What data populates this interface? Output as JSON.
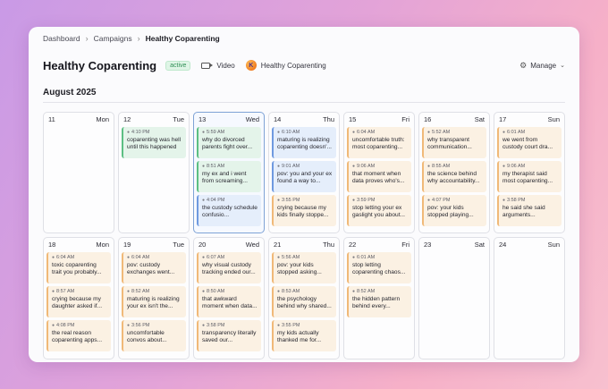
{
  "breadcrumb": [
    "Dashboard",
    "Campaigns",
    "Healthy Coparenting"
  ],
  "header": {
    "title": "Healthy Coparenting",
    "status": "active",
    "format": "Video",
    "account": "Healthy Coparenting",
    "manage": "Manage"
  },
  "month": "August 2025",
  "colors": {
    "peach": "#f0b978",
    "green": "#5cbf83",
    "blue": "#6f9ae0"
  },
  "days": [
    {
      "num": "11",
      "dow": "Mon",
      "events": []
    },
    {
      "num": "12",
      "dow": "Tue",
      "events": [
        {
          "time": "4:10 PM",
          "text": "coparenting was hell until this happened",
          "color": "green"
        }
      ]
    },
    {
      "num": "13",
      "dow": "Wed",
      "today": true,
      "events": [
        {
          "time": "5:59 AM",
          "text": "why do divorced parents fight over...",
          "color": "green"
        },
        {
          "time": "8:51 AM",
          "text": "my ex and i went from screaming...",
          "color": "green"
        },
        {
          "time": "4:04 PM",
          "text": "the custody schedule confusio...",
          "color": "blue"
        }
      ]
    },
    {
      "num": "14",
      "dow": "Thu",
      "events": [
        {
          "time": "6:10 AM",
          "text": "maturing is realizing coparenting doesn'...",
          "color": "blue"
        },
        {
          "time": "9:01 AM",
          "text": "pov: you and your ex found a way to...",
          "color": "blue"
        },
        {
          "time": "3:55 PM",
          "text": "crying because my kids finally stoppe...",
          "color": "peach"
        }
      ]
    },
    {
      "num": "15",
      "dow": "Fri",
      "events": [
        {
          "time": "6:04 AM",
          "text": "uncomfortable truth: most coparenting...",
          "color": "peach"
        },
        {
          "time": "9:06 AM",
          "text": "that moment when data proves who's...",
          "color": "peach"
        },
        {
          "time": "3:59 PM",
          "text": "stop letting your ex gaslight you about...",
          "color": "peach"
        }
      ]
    },
    {
      "num": "16",
      "dow": "Sat",
      "events": [
        {
          "time": "5:52 AM",
          "text": "why transparent communication...",
          "color": "peach"
        },
        {
          "time": "8:55 AM",
          "text": "the science behind why accountability...",
          "color": "peach"
        },
        {
          "time": "4:07 PM",
          "text": "pov: your kids stopped playing...",
          "color": "peach"
        }
      ]
    },
    {
      "num": "17",
      "dow": "Sun",
      "events": [
        {
          "time": "6:01 AM",
          "text": "we went from custody court dra...",
          "color": "peach"
        },
        {
          "time": "9:06 AM",
          "text": "my therapist said most coparenting...",
          "color": "peach"
        },
        {
          "time": "3:58 PM",
          "text": "he said she said arguments...",
          "color": "peach"
        }
      ]
    },
    {
      "num": "18",
      "dow": "Mon",
      "events": [
        {
          "time": "6:04 AM",
          "text": "toxic coparenting trait you probably...",
          "color": "peach"
        },
        {
          "time": "8:57 AM",
          "text": "crying because my daughter asked if...",
          "color": "peach"
        },
        {
          "time": "4:08 PM",
          "text": "the real reason coparenting apps...",
          "color": "peach"
        }
      ]
    },
    {
      "num": "19",
      "dow": "Tue",
      "events": [
        {
          "time": "6:04 AM",
          "text": "pov: custody exchanges went...",
          "color": "peach"
        },
        {
          "time": "8:52 AM",
          "text": "maturing is realizing your ex isn't the...",
          "color": "peach"
        },
        {
          "time": "3:56 PM",
          "text": "uncomfortable convos about...",
          "color": "peach"
        }
      ]
    },
    {
      "num": "20",
      "dow": "Wed",
      "events": [
        {
          "time": "6:07 AM",
          "text": "why visual custody tracking ended our...",
          "color": "peach"
        },
        {
          "time": "8:50 AM",
          "text": "that awkward moment when data...",
          "color": "peach"
        },
        {
          "time": "3:58 PM",
          "text": "transparency literally saved our...",
          "color": "peach"
        }
      ]
    },
    {
      "num": "21",
      "dow": "Thu",
      "events": [
        {
          "time": "5:56 AM",
          "text": "pov: your kids stopped asking...",
          "color": "peach"
        },
        {
          "time": "8:53 AM",
          "text": "the psychology behind why shared...",
          "color": "peach"
        },
        {
          "time": "3:55 PM",
          "text": "my kids actually thanked me for...",
          "color": "peach"
        }
      ]
    },
    {
      "num": "22",
      "dow": "Fri",
      "events": [
        {
          "time": "6:01 AM",
          "text": "stop letting coparenting chaos...",
          "color": "peach"
        },
        {
          "time": "8:52 AM",
          "text": "the hidden pattern behind every...",
          "color": "peach"
        }
      ]
    },
    {
      "num": "23",
      "dow": "Sat",
      "events": []
    },
    {
      "num": "24",
      "dow": "Sun",
      "events": []
    }
  ]
}
